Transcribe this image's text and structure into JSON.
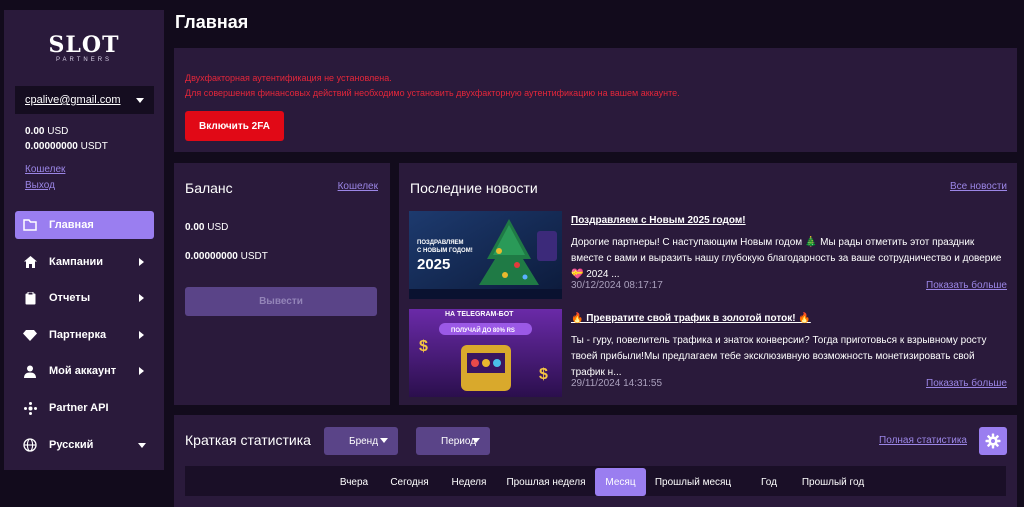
{
  "brand": {
    "logo_main": "SLOT",
    "logo_sub": "PARTNERS"
  },
  "user": {
    "email": "cpalive@gmail.com",
    "balance_usd_value": "0.00",
    "balance_usd_unit": "USD",
    "balance_usdt_value": "0.00000000",
    "balance_usdt_unit": "USDT",
    "wallet_link": "Кошелек",
    "exit_link": "Выход"
  },
  "nav": {
    "home": "Главная",
    "campaigns": "Кампании",
    "reports": "Отчеты",
    "partner": "Партнерка",
    "account": "Мой аккаунт",
    "api": "Partner API",
    "language": "Русский"
  },
  "page": {
    "title": "Главная"
  },
  "alert": {
    "line1": "Двухфакторная аутентификация не установлена.",
    "line2": "Для совершения финансовых действий необходимо установить двухфакторную аутентификацию на вашем аккаунте.",
    "button": "Включить 2FA"
  },
  "balance": {
    "title": "Баланс",
    "link": "Кошелек",
    "usd_value": "0.00",
    "usd_unit": "USD",
    "usdt_value": "0.00000000",
    "usdt_unit": "USDT",
    "withdraw": "Вывести"
  },
  "news": {
    "title": "Последние новости",
    "all_link": "Все новости",
    "items": [
      {
        "title": "Поздравляем с Новым 2025 годом!",
        "text": "Дорогие партнеры! С наступающим Новым годом 🎄 Мы рады отметить этот праздник вместе с вами и выразить нашу глубокую благодарность за ваше сотрудничество и доверие 💝 2024 ...",
        "date": "30/12/2024 08:17:17",
        "more": "Показать больше",
        "thumb_line1": "ПОЗДРАВЛЯЕМ",
        "thumb_line2": "С НОВЫМ ГОДОМ!",
        "thumb_year": "2025"
      },
      {
        "title": "🔥 Превратите свой трафик в золотой поток! 🔥",
        "text": "Ты - гуру, повелитель трафика и знаток конверсии? Тогда приготовься к взрывному росту твоей прибыли!Мы предлагаем тебе эксклюзивную возможность монетизировать свой трафик н...",
        "date": "29/11/2024 14:31:55",
        "more": "Показать больше",
        "thumb_line1": "НА TELEGRAM-БОТ",
        "thumb_line2": "ПОЛУЧАЙ ДО 80% RS"
      }
    ]
  },
  "stats": {
    "title": "Краткая статистика",
    "brand_dd": "Бренд",
    "period_dd": "Период",
    "full_link": "Полная статистика",
    "tabs": [
      "Вчера",
      "Сегодня",
      "Неделя",
      "Прошлая неделя",
      "Месяц",
      "Прошлый месяц",
      "Год",
      "Прошлый год"
    ],
    "active_tab": "Месяц"
  },
  "colors": {
    "accent": "#9a7ef0",
    "danger": "#e10916",
    "panel": "#2a1a3b",
    "background": "#120b1c"
  }
}
